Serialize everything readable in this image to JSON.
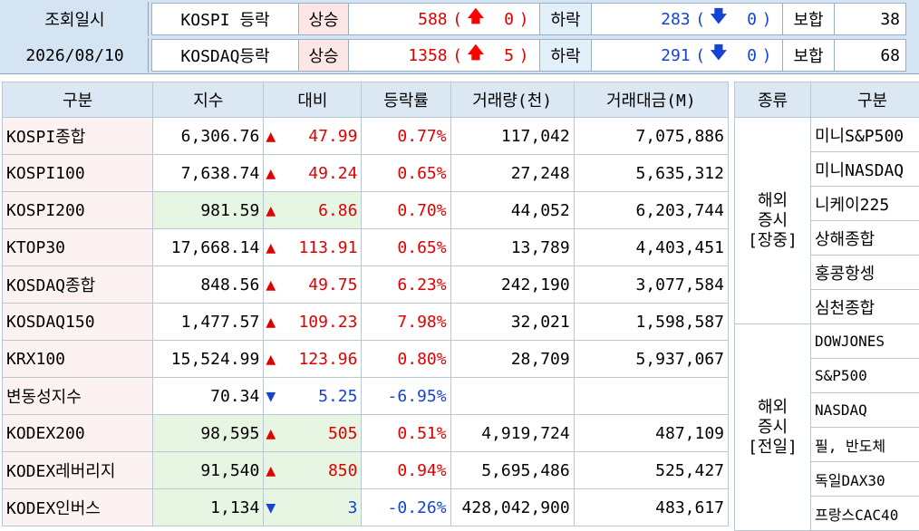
{
  "summary": {
    "label": "조회일시",
    "date": "2026/08/10",
    "rows": [
      {
        "market": "KOSPI 등락",
        "up_label": "상승",
        "up_count": "588",
        "up_limit": "0",
        "down_label": "하락",
        "down_count": "283",
        "down_limit": "0",
        "flat_label": "보합",
        "flat_count": "38"
      },
      {
        "market": "KOSDAQ등락",
        "up_label": "상승",
        "up_count": "1358",
        "up_limit": "5",
        "down_label": "하락",
        "down_count": "291",
        "down_limit": "0",
        "flat_label": "보합",
        "flat_count": "68"
      }
    ],
    "colors": {
      "up": "#e00000",
      "down": "#1543d3",
      "header_bg": "#d4e4f3"
    }
  },
  "index_table": {
    "headers": [
      "구분",
      "지수",
      "대비",
      "등락률",
      "거래량(천)",
      "거래대금(M)"
    ],
    "rows": [
      {
        "name": "KOSPI종합",
        "index": "6,306.76",
        "dir": "up",
        "change": "47.99",
        "rate": "0.77%",
        "volume": "117,042",
        "amount": "7,075,886"
      },
      {
        "name": "KOSPI100",
        "index": "7,638.74",
        "dir": "up",
        "change": "49.24",
        "rate": "0.65%",
        "volume": "27,248",
        "amount": "5,635,312"
      },
      {
        "name": "KOSPI200",
        "index": "981.59",
        "dir": "up",
        "change": "6.86",
        "rate": "0.70%",
        "volume": "44,052",
        "amount": "6,203,744"
      },
      {
        "name": "KTOP30",
        "index": "17,668.14",
        "dir": "up",
        "change": "113.91",
        "rate": "0.65%",
        "volume": "13,789",
        "amount": "4,403,451"
      },
      {
        "name": "KOSDAQ종합",
        "index": "848.56",
        "dir": "up",
        "change": "49.75",
        "rate": "6.23%",
        "volume": "242,190",
        "amount": "3,077,584"
      },
      {
        "name": "KOSDAQ150",
        "index": "1,477.57",
        "dir": "up",
        "change": "109.23",
        "rate": "7.98%",
        "volume": "32,021",
        "amount": "1,598,587"
      },
      {
        "name": "KRX100",
        "index": "15,524.99",
        "dir": "up",
        "change": "123.96",
        "rate": "0.80%",
        "volume": "28,709",
        "amount": "5,937,067"
      },
      {
        "name": "변동성지수",
        "index": "70.34",
        "dir": "down",
        "change": "5.25",
        "rate": "-6.95%",
        "volume": "",
        "amount": ""
      },
      {
        "name": "KODEX200",
        "index": "98,595",
        "dir": "up",
        "change": "505",
        "rate": "0.51%",
        "volume": "4,919,724",
        "amount": "487,109"
      },
      {
        "name": "KODEX레버리지",
        "index": "91,540",
        "dir": "up",
        "change": "850",
        "rate": "0.94%",
        "volume": "5,695,486",
        "amount": "525,427"
      },
      {
        "name": "KODEX인버스",
        "index": "1,134",
        "dir": "down",
        "change": "3",
        "rate": "-0.26%",
        "volume": "428,042,900",
        "amount": "483,617"
      }
    ]
  },
  "overseas": {
    "headers": [
      "종류",
      "구분"
    ],
    "groups": [
      {
        "label_lines": [
          "해외",
          "증시",
          "[장중]"
        ],
        "items": [
          "미니S&P500",
          "미니NASDAQ",
          "니케이225",
          "상해종합",
          "홍콩항셍",
          "심천종합"
        ]
      },
      {
        "label_lines": [
          "해외",
          "증시",
          "[전일]"
        ],
        "items": [
          "DOWJONES",
          "S&P500",
          "NASDAQ",
          "필, 반도체",
          "독일DAX30",
          "프랑스CAC40"
        ]
      }
    ]
  }
}
